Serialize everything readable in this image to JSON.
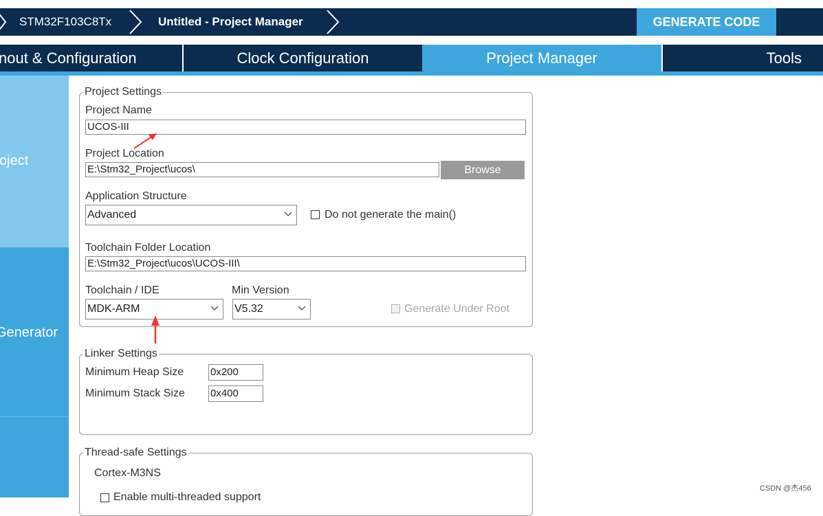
{
  "breadcrumb": {
    "items": [
      "STM32F103C8Tx",
      "Untitled - Project Manager"
    ]
  },
  "toolbar": {
    "generate_label": "GENERATE CODE"
  },
  "tabs": [
    {
      "label": "nout & Configuration",
      "active": false
    },
    {
      "label": "Clock Configuration",
      "active": false
    },
    {
      "label": "Project Manager",
      "active": true
    },
    {
      "label": "Tools",
      "active": false
    }
  ],
  "sidebar": {
    "items": [
      {
        "label": "oject",
        "active": true
      },
      {
        "label": "Generator",
        "active": false
      },
      {
        "label": "",
        "active": false
      }
    ]
  },
  "project_settings": {
    "legend": "Project Settings",
    "name_label": "Project Name",
    "name_value": "UCOS-III",
    "location_label": "Project Location",
    "location_value": "E:\\Stm32_Project\\ucos\\",
    "browse_label": "Browse",
    "structure_label": "Application Structure",
    "structure_value": "Advanced",
    "no_main_label": "Do not generate the main()",
    "no_main_checked": false,
    "toolchain_folder_label": "Toolchain Folder Location",
    "toolchain_folder_value": "E:\\Stm32_Project\\ucos\\UCOS-III\\",
    "toolchain_label": "Toolchain / IDE",
    "toolchain_value": "MDK-ARM",
    "min_version_label": "Min Version",
    "min_version_value": "V5.32",
    "gen_under_root_label": "Generate Under Root",
    "gen_under_root_checked": false
  },
  "linker_settings": {
    "legend": "Linker Settings",
    "heap_label": "Minimum Heap Size",
    "heap_value": "0x200",
    "stack_label": "Minimum Stack Size",
    "stack_value": "0x400"
  },
  "thread_safe": {
    "legend": "Thread-safe Settings",
    "core_label": "Cortex-M3NS",
    "multithread_label": "Enable multi-threaded support"
  },
  "annotation": {
    "arrow_color": "#e8392e"
  },
  "colors": {
    "navy": "#0b2c4f",
    "accent": "#3ea6dd",
    "side_active": "#82c8ec"
  },
  "watermark": "CSDN @杰456"
}
